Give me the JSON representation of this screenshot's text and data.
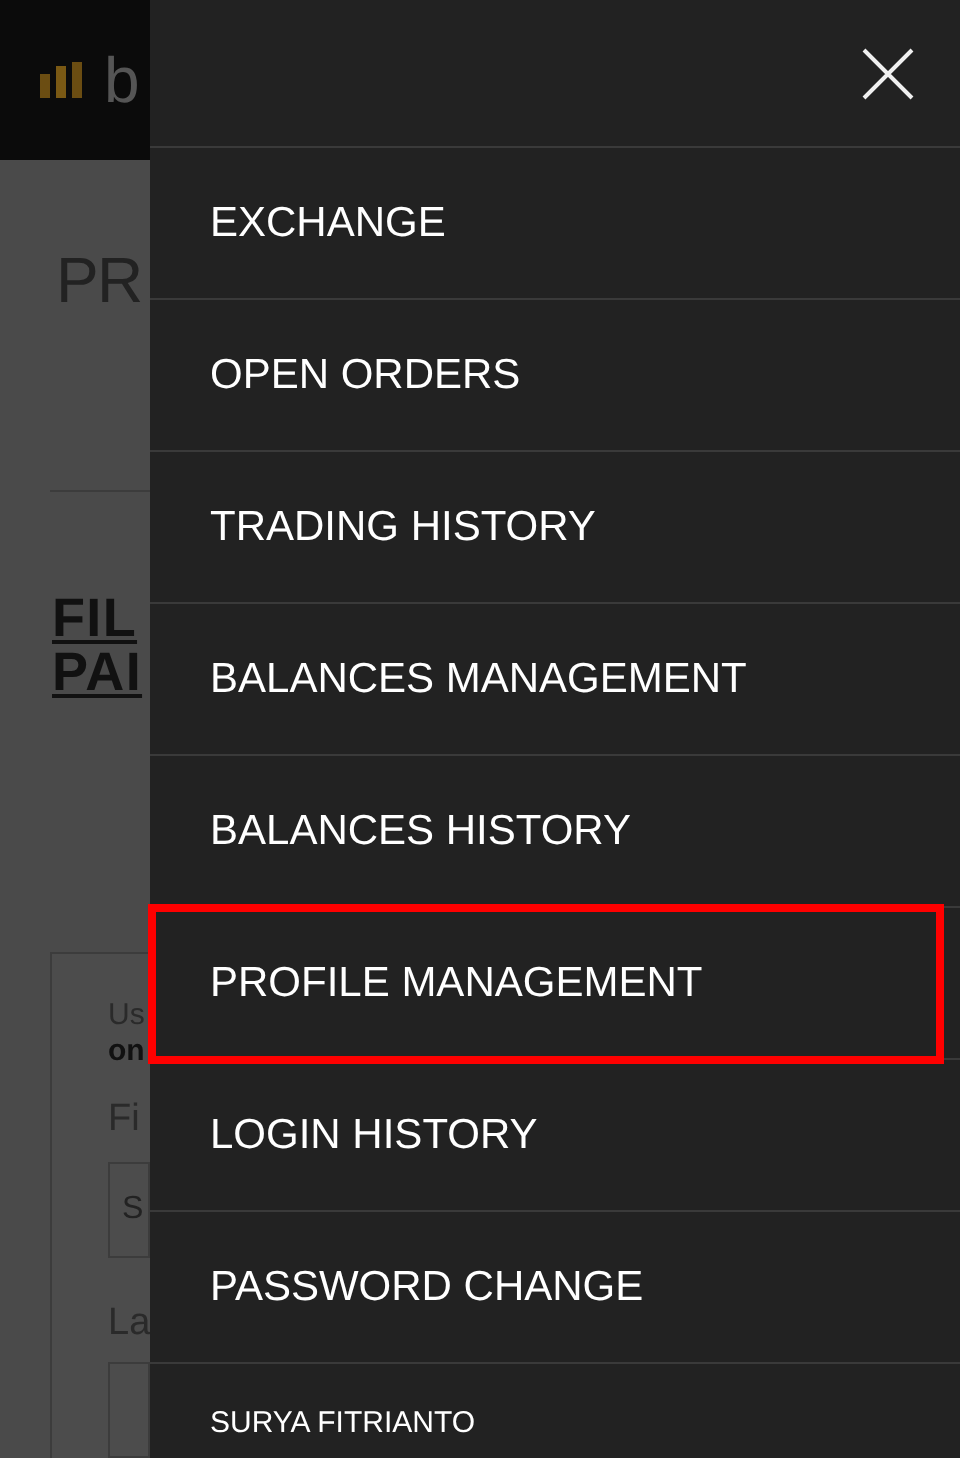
{
  "page": {
    "logo_text": "b",
    "title": "PR",
    "section_heading": [
      "FIL",
      "PAI"
    ],
    "card": {
      "note": [
        "Us",
        "on"
      ],
      "first_label": "Fi",
      "first_value": "S",
      "last_label": "La"
    }
  },
  "menu": {
    "items": [
      {
        "label": "EXCHANGE",
        "selected": false
      },
      {
        "label": "OPEN ORDERS",
        "selected": false
      },
      {
        "label": "TRADING HISTORY",
        "selected": false
      },
      {
        "label": "BALANCES MANAGEMENT",
        "selected": false
      },
      {
        "label": "BALANCES HISTORY",
        "selected": false
      },
      {
        "label": "PROFILE MANAGEMENT",
        "selected": true
      },
      {
        "label": "LOGIN HISTORY",
        "selected": false
      },
      {
        "label": "PASSWORD CHANGE",
        "selected": false
      }
    ],
    "user_name": "SURYA FITRIANTO"
  }
}
